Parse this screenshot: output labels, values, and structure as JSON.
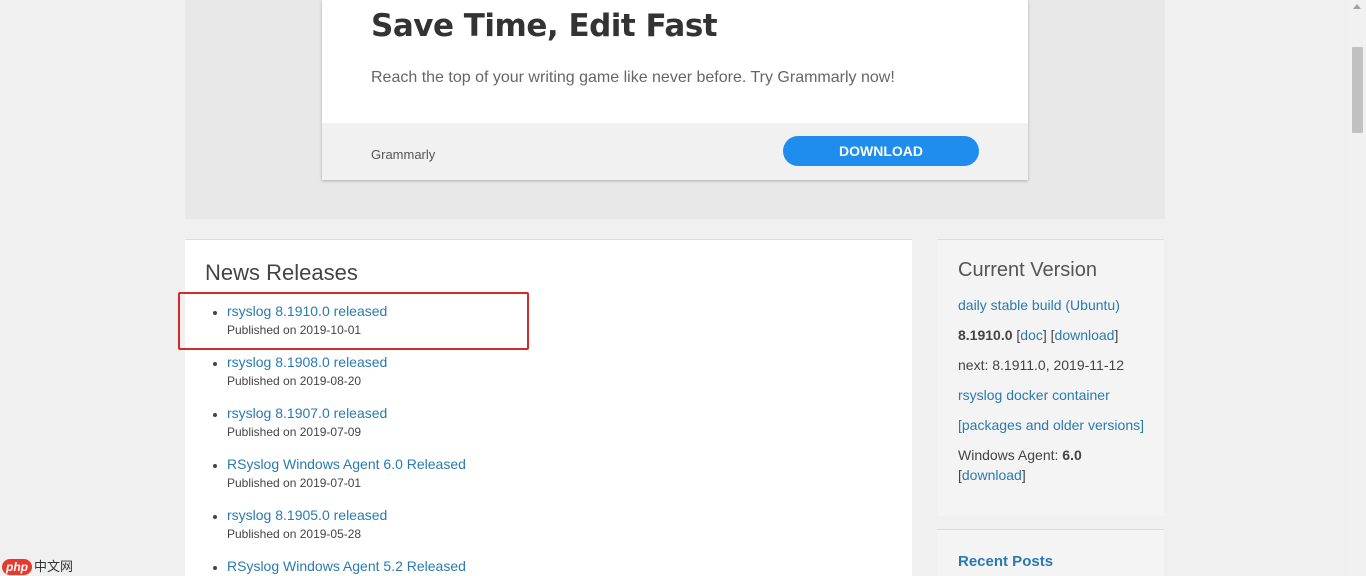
{
  "ad": {
    "title": "Save Time, Edit Fast",
    "subtitle": "Reach the top of your writing game like never before. Try Grammarly now!",
    "brand": "Grammarly",
    "button_label": "DOWNLOAD"
  },
  "news": {
    "title": "News Releases",
    "items": [
      {
        "label": "rsyslog 8.1910.0 released",
        "date": "Published on 2019-10-01"
      },
      {
        "label": "rsyslog 8.1908.0 released",
        "date": "Published on 2019-08-20"
      },
      {
        "label": "rsyslog 8.1907.0 released",
        "date": "Published on 2019-07-09"
      },
      {
        "label": "RSyslog Windows Agent 6.0 Released",
        "date": "Published on 2019-07-01"
      },
      {
        "label": "rsyslog 8.1905.0 released",
        "date": "Published on 2019-05-28"
      },
      {
        "label": "RSyslog Windows Agent 5.2 Released",
        "date": ""
      }
    ]
  },
  "sidebar": {
    "current_title": "Current Version",
    "daily_build": "daily stable build (Ubuntu)",
    "version": "8.1910.0",
    "doc_link": "doc",
    "download_link": "download",
    "next_release": "next: 8.1911.0, 2019-11-12",
    "docker_link": "rsyslog docker container",
    "packages_link": "[packages and older versions]",
    "windows_agent_label": "Windows Agent: ",
    "windows_agent_version": "6.0",
    "windows_download_link": "download",
    "recent_title": "Recent Posts"
  },
  "watermark": {
    "logo": "php",
    "text": "中文网"
  },
  "colors": {
    "link": "#2a7ab0",
    "button": "#1f8ded",
    "highlight": "#d12b2b"
  }
}
